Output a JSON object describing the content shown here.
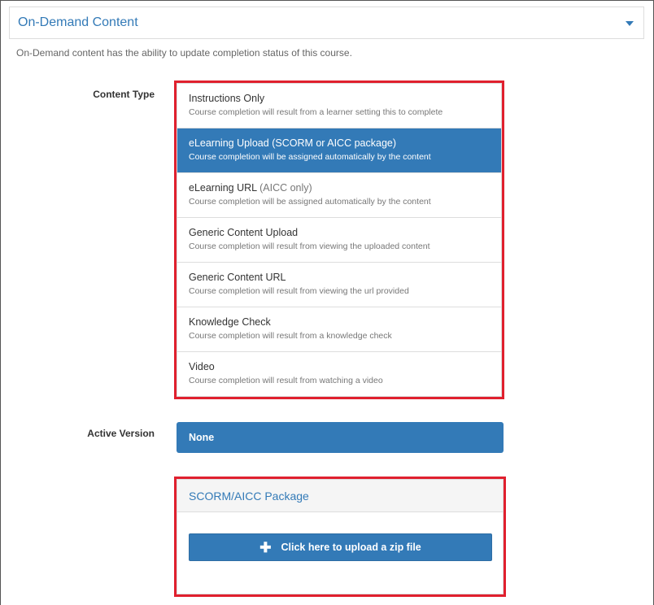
{
  "panel": {
    "title": "On-Demand Content",
    "description": "On-Demand content has the ability to update completion status of this course."
  },
  "content_type": {
    "label": "Content Type",
    "options": [
      {
        "name": "Instructions Only",
        "note": "",
        "desc": "Course completion will result from a learner setting this to complete",
        "selected": false
      },
      {
        "name": "eLearning Upload",
        "note": "(SCORM or AICC package)",
        "desc": "Course completion will be assigned automatically by the content",
        "selected": true
      },
      {
        "name": "eLearning URL",
        "note": "(AICC only)",
        "desc": "Course completion will be assigned automatically by the content",
        "selected": false
      },
      {
        "name": "Generic Content Upload",
        "note": "",
        "desc": "Course completion will result from viewing the uploaded content",
        "selected": false
      },
      {
        "name": "Generic Content URL",
        "note": "",
        "desc": "Course completion will result from viewing the url provided",
        "selected": false
      },
      {
        "name": "Knowledge Check",
        "note": "",
        "desc": "Course completion will result from a knowledge check",
        "selected": false
      },
      {
        "name": "Video",
        "note": "",
        "desc": "Course completion will result from watching a video",
        "selected": false
      }
    ]
  },
  "active_version": {
    "label": "Active Version",
    "value": "None"
  },
  "scorm": {
    "title": "SCORM/AICC Package",
    "upload_label": "Click here to upload a zip file",
    "upload_icon": "plus-icon"
  },
  "colors": {
    "accent": "#337ab7",
    "highlight": "#e0202e"
  }
}
